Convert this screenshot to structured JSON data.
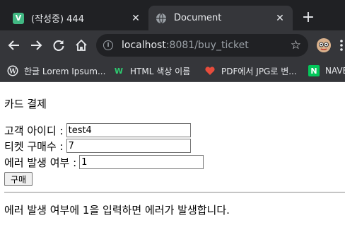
{
  "browser": {
    "tabs": [
      {
        "title": "(작성중) 444",
        "favicon": "V",
        "favicon_color": "#41b883"
      },
      {
        "title": "Document",
        "favicon": "globe"
      }
    ],
    "url_host": "localhost",
    "url_rest": ":8081/buy_ticket",
    "bookmarks": [
      {
        "label": "한글 Lorem Ipsum...",
        "icon": "wordpress"
      },
      {
        "label": "HTML 색상 이름",
        "icon": "W"
      },
      {
        "label": "PDF에서 JPG로 변...",
        "icon": "heart"
      },
      {
        "label": "NAVER",
        "icon": "N"
      }
    ]
  },
  "page": {
    "title": "카드 결제",
    "fields": [
      {
        "label": "고객 아이디 :",
        "value": "test4"
      },
      {
        "label": "티켓 구매수 :",
        "value": "7"
      },
      {
        "label": "에러 발생 여부 :",
        "value": "1"
      }
    ],
    "buy_button": "구매",
    "notice": "에러 발생 여부에 1을 입력하면 에러가 발생합니다."
  }
}
